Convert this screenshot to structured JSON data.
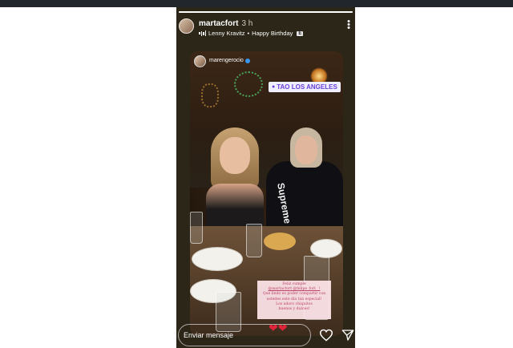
{
  "story": {
    "progress_fraction": 1.0,
    "username": "martacfort",
    "time": "3 h",
    "music": {
      "artist": "Lenny Kravitz",
      "separator": "•",
      "track": "Happy Birthday",
      "explicit_badge": "E"
    },
    "more_icon": "three-dots-vertical"
  },
  "repost": {
    "username": "marengerocio",
    "location": "TAO LOS ANGELES",
    "shirt_text": "Supreme",
    "card_lines": [
      "Feliz cumple",
      "@martacfort @felipe_fort_ !",
      "Que lindo es poder compartir con",
      "ustedes este día tan especial!",
      "Los adoro chiquitos",
      "buenos y dulces!"
    ],
    "hearts": "❤❤"
  },
  "footer": {
    "message_placeholder": "Enviar mensaje",
    "like_icon": "heart-outline",
    "send_icon": "paper-plane"
  }
}
